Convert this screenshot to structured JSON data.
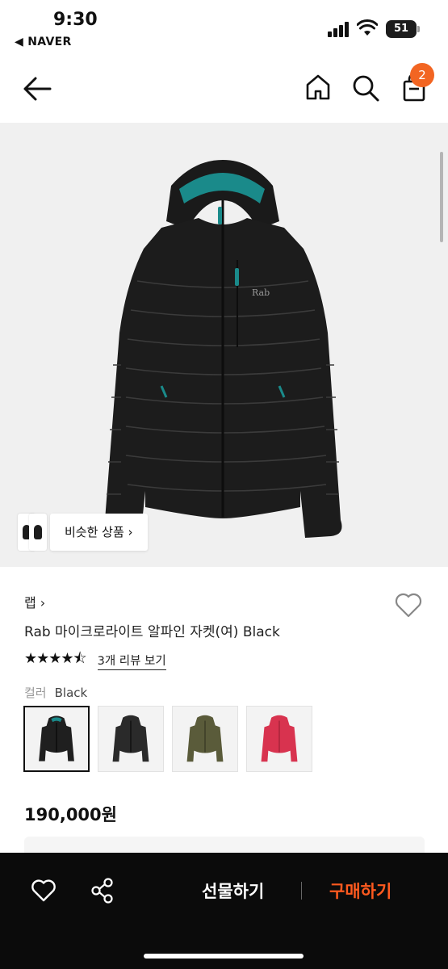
{
  "status": {
    "time": "9:30",
    "back_app": "◀ NAVER",
    "battery": "51"
  },
  "nav": {
    "cart_count": "2",
    "accent": "#f26522"
  },
  "hero": {
    "jacket_brand_mark": "Rab",
    "similar_label": "비슷한 상품 ›"
  },
  "product": {
    "brand": "랩 ›",
    "title": "Rab 마이크로라이트 알파인 자켓(여) Black",
    "rating": 4.5,
    "rating_stars": "★★★★⯪",
    "reviews_link": "3개 리뷰 보기",
    "color_label": "컬러",
    "color_value": "Black",
    "swatches": [
      {
        "name": "Black",
        "color": "#1f1f1f",
        "selected": true
      },
      {
        "name": "Black",
        "color": "#2a2a2a",
        "selected": false
      },
      {
        "name": "Olive",
        "color": "#5a5b3a",
        "selected": false
      },
      {
        "name": "Pink",
        "color": "#d8334f",
        "selected": false
      }
    ],
    "price": "190,000원"
  },
  "bottom_bar": {
    "gift_label": "선물하기",
    "buy_label": "구매하기",
    "buy_color": "#ff5a1f"
  }
}
